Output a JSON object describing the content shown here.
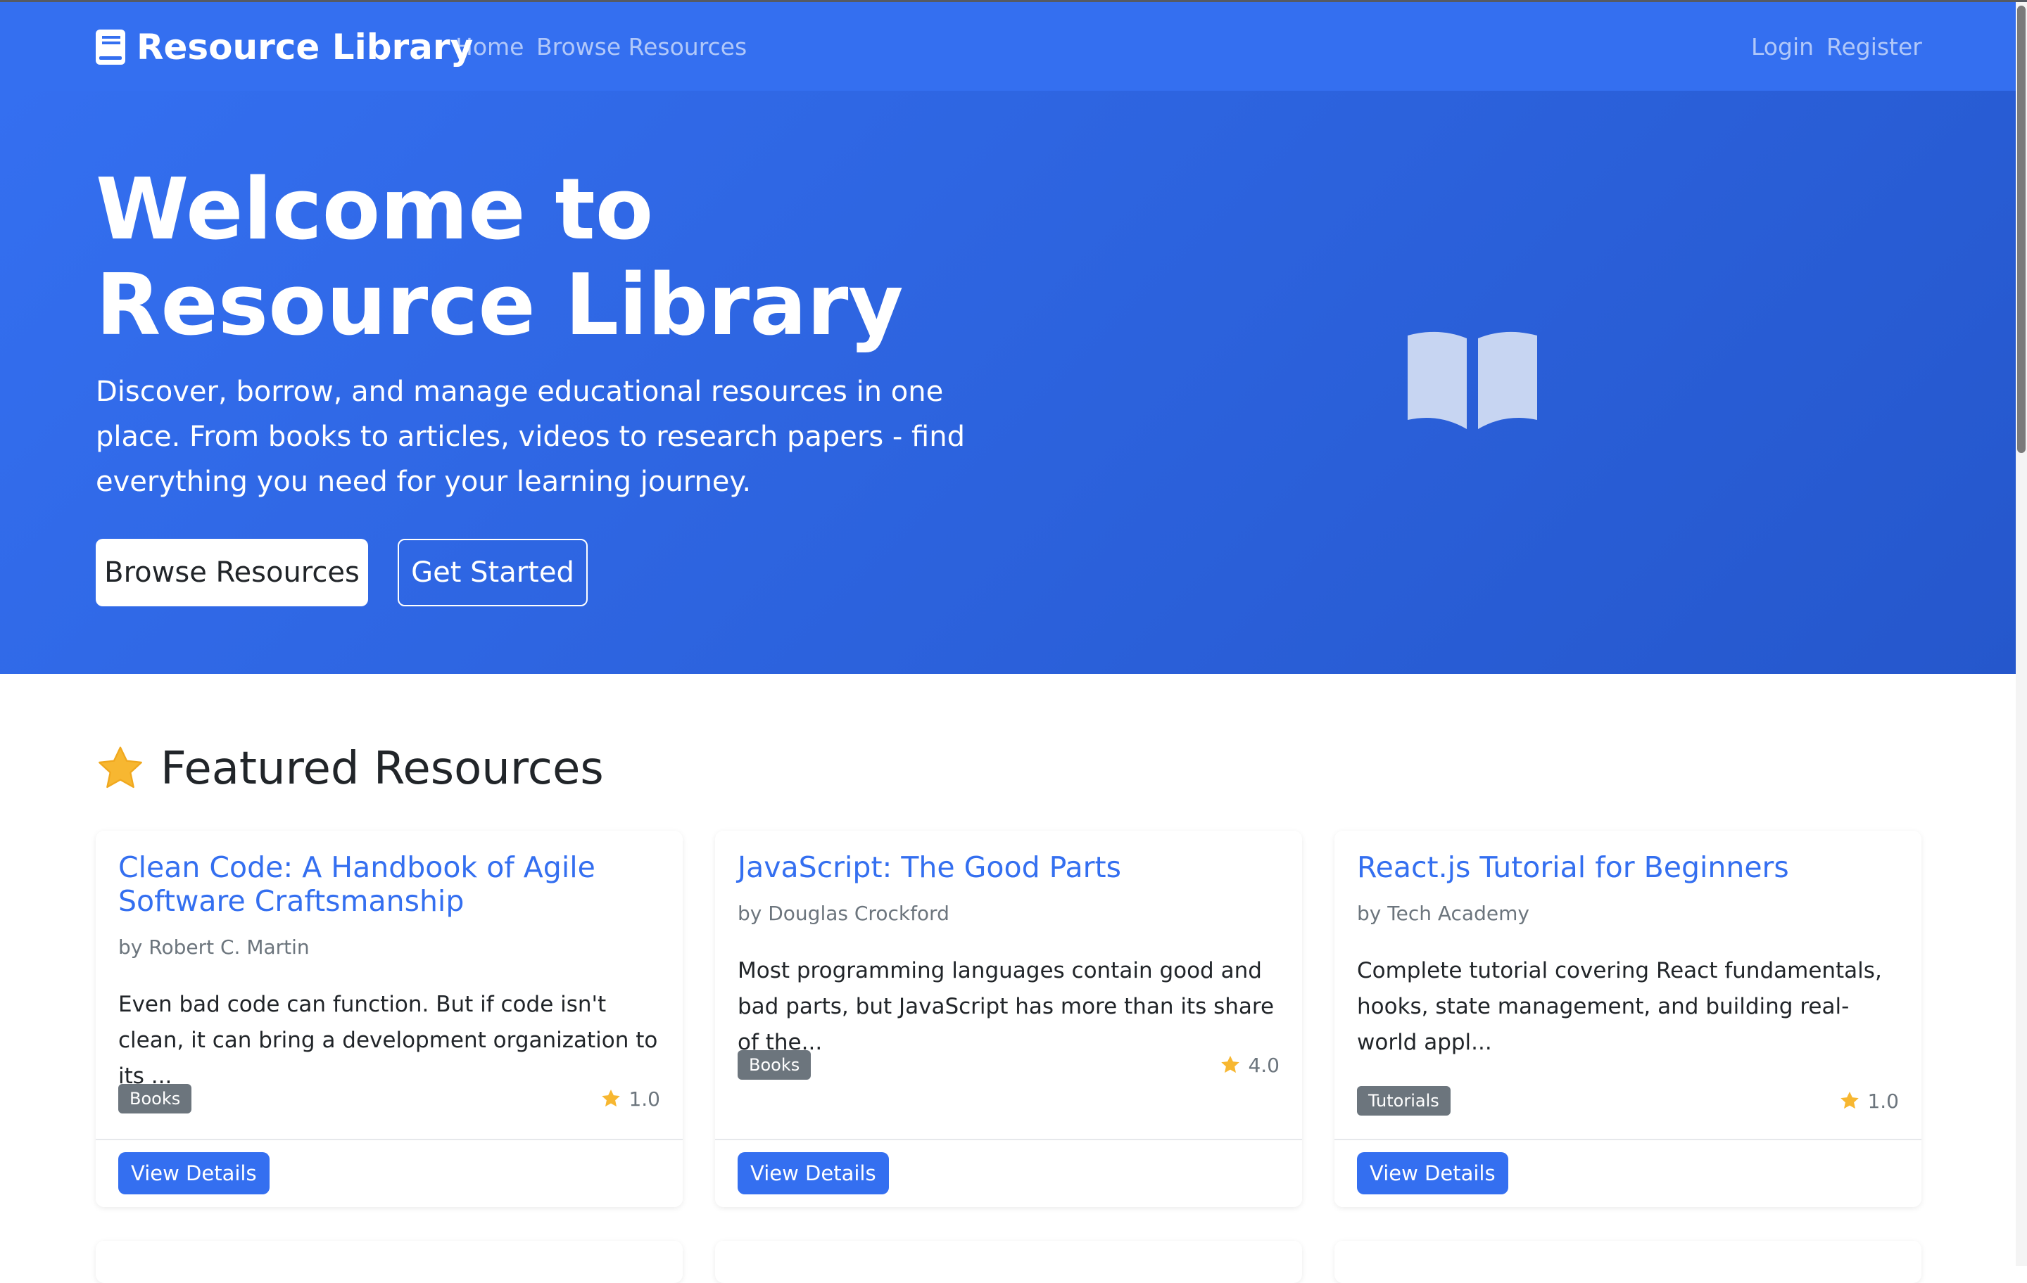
{
  "navbar": {
    "brand": "Resource Library",
    "links": [
      "Home",
      "Browse Resources"
    ],
    "auth_links": [
      "Login",
      "Register"
    ]
  },
  "hero": {
    "title": "Welcome to Resource Library",
    "subtitle": "Discover, borrow, and manage educational resources in one place. From books to articles, videos to research papers - find everything you need for your learning journey.",
    "primary_button": "Browse Resources",
    "secondary_button": "Get Started",
    "illustration_icon": "open-book-icon"
  },
  "featured": {
    "heading": "Featured Resources",
    "heading_icon": "star-icon",
    "cards": [
      {
        "title": "Clean Code: A Handbook of Agile Software Craftsmanship",
        "author": "by Robert C. Martin",
        "description": "Even bad code can function. But if code isn't clean, it can bring a development organization to its ...",
        "category": "Books",
        "rating": "1.0",
        "button": "View Details"
      },
      {
        "title": "JavaScript: The Good Parts",
        "author": "by Douglas Crockford",
        "description": "Most programming languages contain good and bad parts, but JavaScript has more than its share of the...",
        "category": "Books",
        "rating": "4.0",
        "button": "View Details"
      },
      {
        "title": "React.js Tutorial for Beginners",
        "author": "by Tech Academy",
        "description": "Complete tutorial covering React fundamentals, hooks, state management, and building real-world appl...",
        "category": "Tutorials",
        "rating": "1.0",
        "button": "View Details"
      }
    ]
  },
  "colors": {
    "primary": "#346ff0",
    "hero_gradient_end": "#2557cc",
    "badge": "#6c757d",
    "star": "#f7b731"
  }
}
